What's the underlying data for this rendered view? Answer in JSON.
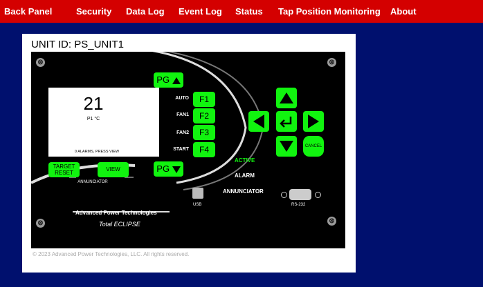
{
  "nav": {
    "items": [
      "Back Panel",
      "Security",
      "Data Log",
      "Event Log",
      "Status",
      "Tap Position Monitoring",
      "About"
    ]
  },
  "unit": {
    "title": "UNIT ID: PS_UNIT1"
  },
  "lcd": {
    "value": "21",
    "unit": "P1 °C",
    "alarm": "0 ALARMS, PRESS VIEW"
  },
  "function_labels": [
    "AUTO",
    "FAN1",
    "FAN2",
    "START"
  ],
  "function_buttons": [
    "F1",
    "F2",
    "F3",
    "F4"
  ],
  "pg_up_label": "PG",
  "pg_down_label": "PG",
  "target_reset_label": "TARGET RESET",
  "view_label": "VIEW",
  "annunciator_label": "ANNUNCIATOR",
  "cancel_label": "CANCEL",
  "status_labels": {
    "active": "ACTIVE",
    "alarm": "ALARM",
    "annunciator": "ANNUNCIATOR"
  },
  "port_labels": {
    "usb": "USB",
    "rs232": "RS-232"
  },
  "brand": {
    "name": "Advanced Power Technologies",
    "product": "Total ECLIPSE"
  },
  "footer": "© 2023 Advanced Power Technologies, LLC. All rights reserved.",
  "colors": {
    "nav_bg": "#d40000",
    "page_bg": "#00106e",
    "button_green": "#11f40f",
    "active_green": "#11f40f"
  }
}
